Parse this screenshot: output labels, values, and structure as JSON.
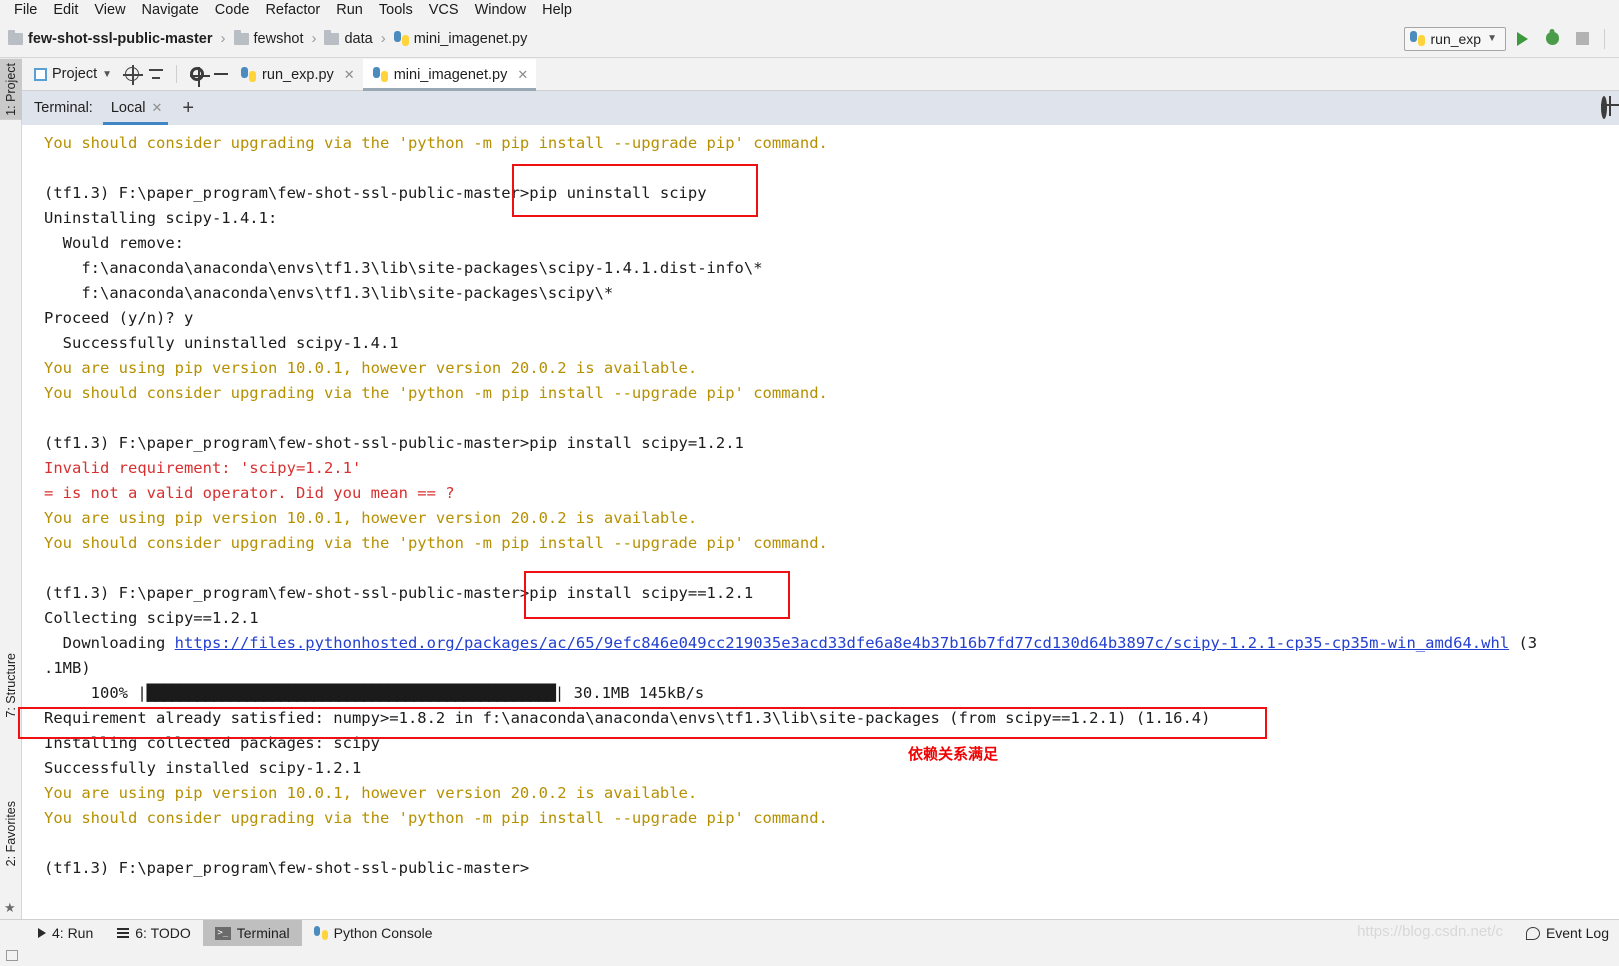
{
  "menu": {
    "items": [
      "File",
      "Edit",
      "View",
      "Navigate",
      "Code",
      "Refactor",
      "Run",
      "Tools",
      "VCS",
      "Window",
      "Help"
    ]
  },
  "breadcrumb": {
    "items": [
      {
        "label": "few-shot-ssl-public-master",
        "icon": "folder-icon"
      },
      {
        "label": "fewshot",
        "icon": "folder-icon"
      },
      {
        "label": "data",
        "icon": "folder-icon"
      },
      {
        "label": "mini_imagenet.py",
        "icon": "python-file-icon"
      }
    ],
    "separator": "›"
  },
  "toolbar": {
    "run_config": "run_exp",
    "run_button": "run-icon",
    "debug_button": "debug-icon",
    "stop_button": "stop-icon"
  },
  "tool_window_bar": {
    "project_button": "Project",
    "locate_icon": "locate-icon",
    "collapse_icon": "collapse-all-icon",
    "settings_icon": "gear-icon",
    "hide_icon": "hide-icon"
  },
  "editor_tabs": [
    {
      "label": "run_exp.py",
      "active": false
    },
    {
      "label": "mini_imagenet.py",
      "active": true
    }
  ],
  "left_rail": [
    {
      "label": "1: Project",
      "selected": true
    },
    {
      "label": "7: Structure",
      "selected": false
    },
    {
      "label": "2: Favorites",
      "selected": false
    }
  ],
  "terminal_header": {
    "title": "Terminal:",
    "tabs": [
      {
        "label": "Local",
        "active": true
      }
    ],
    "add_label": "+",
    "settings_icon": "gear-icon"
  },
  "terminal": {
    "lines": [
      {
        "t": "You should consider upgrading via the 'python -m pip install --upgrade pip' command.",
        "c": "warn"
      },
      {
        "t": "",
        "c": "norm"
      },
      {
        "t": "(tf1.3) F:\\paper_program\\few-shot-ssl-public-master>pip uninstall scipy",
        "c": "norm"
      },
      {
        "t": "Uninstalling scipy-1.4.1:",
        "c": "norm"
      },
      {
        "t": "  Would remove:",
        "c": "norm"
      },
      {
        "t": "    f:\\anaconda\\anaconda\\envs\\tf1.3\\lib\\site-packages\\scipy-1.4.1.dist-info\\*",
        "c": "norm"
      },
      {
        "t": "    f:\\anaconda\\anaconda\\envs\\tf1.3\\lib\\site-packages\\scipy\\*",
        "c": "norm"
      },
      {
        "t": "Proceed (y/n)? y",
        "c": "norm"
      },
      {
        "t": "  Successfully uninstalled scipy-1.4.1",
        "c": "norm"
      },
      {
        "t": "You are using pip version 10.0.1, however version 20.0.2 is available.",
        "c": "warn"
      },
      {
        "t": "You should consider upgrading via the 'python -m pip install --upgrade pip' command.",
        "c": "warn"
      },
      {
        "t": "",
        "c": "norm"
      },
      {
        "t": "(tf1.3) F:\\paper_program\\few-shot-ssl-public-master>pip install scipy=1.2.1",
        "c": "norm"
      },
      {
        "t": "Invalid requirement: 'scipy=1.2.1'",
        "c": "err"
      },
      {
        "t": "= is not a valid operator. Did you mean == ?",
        "c": "err"
      },
      {
        "t": "You are using pip version 10.0.1, however version 20.0.2 is available.",
        "c": "warn"
      },
      {
        "t": "You should consider upgrading via the 'python -m pip install --upgrade pip' command.",
        "c": "warn"
      },
      {
        "t": "",
        "c": "norm"
      },
      {
        "t": "(tf1.3) F:\\paper_program\\few-shot-ssl-public-master>pip install scipy==1.2.1",
        "c": "norm"
      },
      {
        "t": "Collecting scipy==1.2.1",
        "c": "norm"
      }
    ],
    "download_prefix": "  Downloading ",
    "download_url": "https://files.pythonhosted.org/packages/ac/65/9efc846e049cc219035e3acd33dfe6a8e4b37b16b7fd77cd130d64b3897c/scipy-1.2.1-cp35-cp35m-win_amd64.whl",
    "download_suffix": " (3",
    "size_line": ".1MB)",
    "progress": {
      "percent": "100%",
      "bar": "█████████████████████████████████████████████████",
      "stats": "30.1MB 145kB/s"
    },
    "lines_after": [
      {
        "t": "Requirement already satisfied: numpy>=1.8.2 in f:\\anaconda\\anaconda\\envs\\tf1.3\\lib\\site-packages (from scipy==1.2.1) (1.16.4)",
        "c": "norm"
      },
      {
        "t": "Installing collected packages: scipy",
        "c": "norm"
      },
      {
        "t": "Successfully installed scipy-1.2.1",
        "c": "norm"
      },
      {
        "t": "You are using pip version 10.0.1, however version 20.0.2 is available.",
        "c": "warn"
      },
      {
        "t": "You should consider upgrading via the 'python -m pip install --upgrade pip' command.",
        "c": "warn"
      },
      {
        "t": "",
        "c": "norm"
      },
      {
        "t": "(tf1.3) F:\\paper_program\\few-shot-ssl-public-master>",
        "c": "norm"
      }
    ]
  },
  "annotations": {
    "note_cn": "依赖关系满足",
    "box_color": "#ef1111"
  },
  "status_bar": {
    "items": [
      {
        "label": "4: Run",
        "icon": "run-icon",
        "selected": false
      },
      {
        "label": "6: TODO",
        "icon": "list-icon",
        "selected": false
      },
      {
        "label": "Terminal",
        "icon": "terminal-icon",
        "selected": true
      },
      {
        "label": "Python Console",
        "icon": "python-icon",
        "selected": false
      }
    ],
    "event_log": "Event Log"
  },
  "watermark": "https://blog.csdn.net/c",
  "colors": {
    "warn": "#b59000",
    "error": "#d83030",
    "link": "#2440d0",
    "accent": "#4285c5"
  }
}
